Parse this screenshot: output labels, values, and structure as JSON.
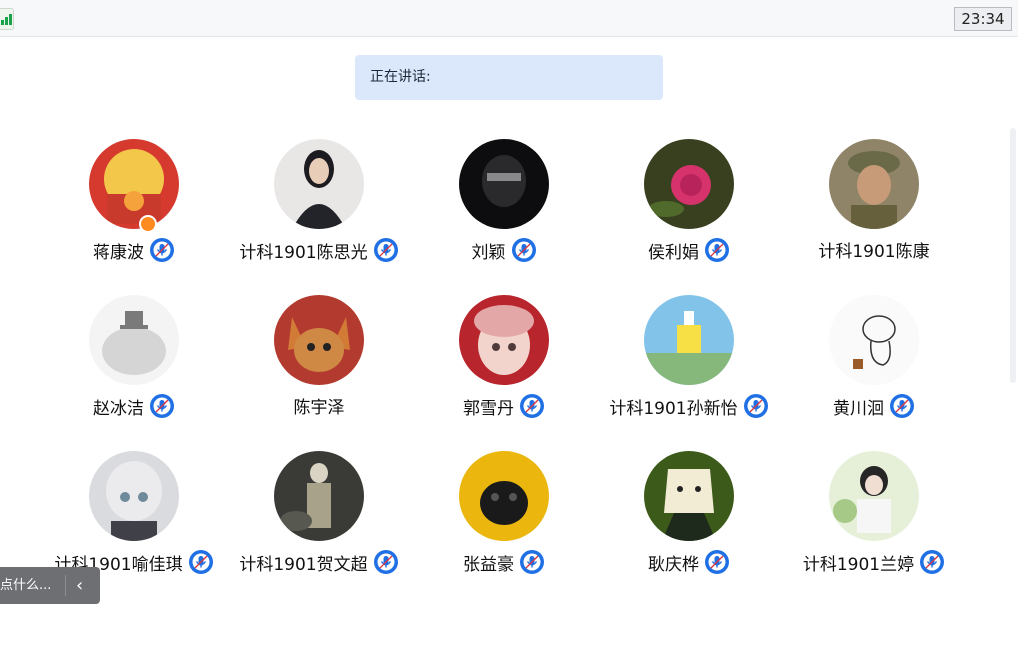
{
  "topbar": {
    "signal_icon": "signal-bars-icon",
    "time": "23:34"
  },
  "speaking": {
    "label": "正在讲话:"
  },
  "participants": [
    {
      "name": "蒋康波",
      "mic": true,
      "host_badge": true
    },
    {
      "name": "计科1901陈思光",
      "mic": true
    },
    {
      "name": "刘颖",
      "mic": true
    },
    {
      "name": "侯利娟",
      "mic": true
    },
    {
      "name": "计科1901陈康",
      "mic": false
    },
    {
      "name": "赵冰洁",
      "mic": true
    },
    {
      "name": "陈宇泽",
      "mic": false
    },
    {
      "name": "郭雪丹",
      "mic": true
    },
    {
      "name": "计科1901孙新怡",
      "mic": true
    },
    {
      "name": "黄川洄",
      "mic": true
    },
    {
      "name": "计科1901喻佳琪",
      "mic": true
    },
    {
      "name": "计科1901贺文超",
      "mic": true
    },
    {
      "name": "张益豪",
      "mic": true
    },
    {
      "name": "耿庆桦",
      "mic": true
    },
    {
      "name": "计科1901兰婷",
      "mic": true
    }
  ],
  "float_button": {
    "text": "点什么...",
    "arrow_icon": "chevron-left-icon"
  },
  "colors": {
    "mic_blue": "#1f6fe5",
    "speaking_bg": "#dbe8fb",
    "host_orange": "#ff8a1f"
  }
}
